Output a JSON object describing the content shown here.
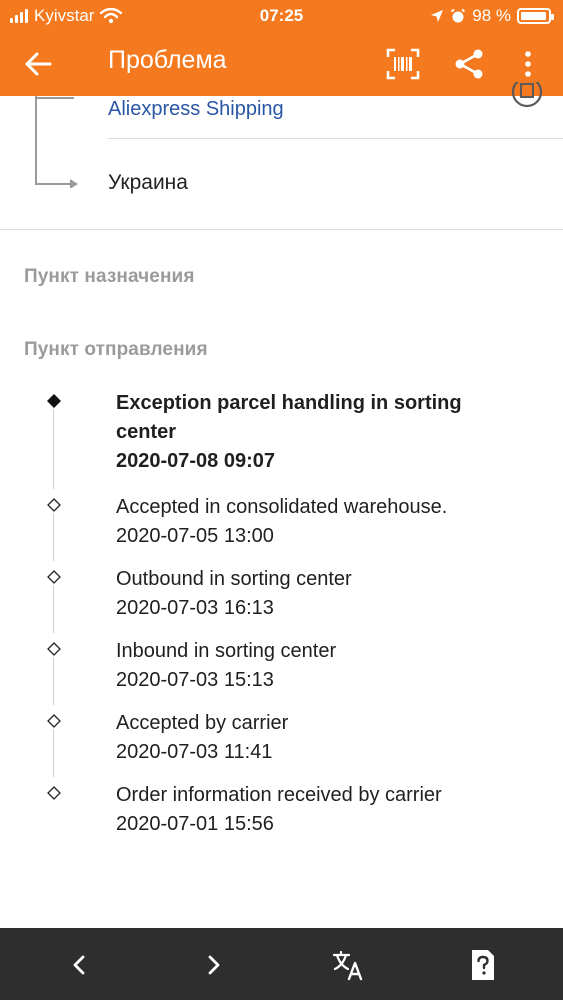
{
  "status_bar": {
    "carrier": "Kyivstar",
    "time": "07:25",
    "battery": "98 %",
    "battery_level": 0.98
  },
  "app_bar": {
    "title": "Проблема",
    "icons": [
      "back-arrow-icon",
      "barcode-scan-icon",
      "share-icon",
      "more-vert-icon"
    ]
  },
  "route": {
    "carrier_name": "Aliexpress Shipping",
    "destination_country": "Украина"
  },
  "sections": {
    "destination_label": "Пункт назначения",
    "origin_label": "Пункт отправления"
  },
  "events": [
    {
      "title": "Exception parcel handling in sorting center",
      "datetime": "2020-07-08 09:07",
      "current": true
    },
    {
      "title": "Accepted in consolidated warehouse.",
      "datetime": "2020-07-05 13:00",
      "current": false
    },
    {
      "title": "Outbound in sorting center",
      "datetime": "2020-07-03 16:13",
      "current": false
    },
    {
      "title": "Inbound in sorting center",
      "datetime": "2020-07-03 15:13",
      "current": false
    },
    {
      "title": "Accepted by carrier",
      "datetime": "2020-07-03 11:41",
      "current": false
    },
    {
      "title": "Order information received by carrier",
      "datetime": "2020-07-01 15:56",
      "current": false
    }
  ],
  "bottom_bar": {
    "icons": [
      "prev-chevron-icon",
      "next-chevron-icon",
      "translate-icon",
      "help-document-icon"
    ]
  },
  "colors": {
    "accent": "#f57a1f",
    "link": "#2a56a6",
    "muted": "#9b9b9b",
    "toolbar": "#2e2e2e"
  }
}
